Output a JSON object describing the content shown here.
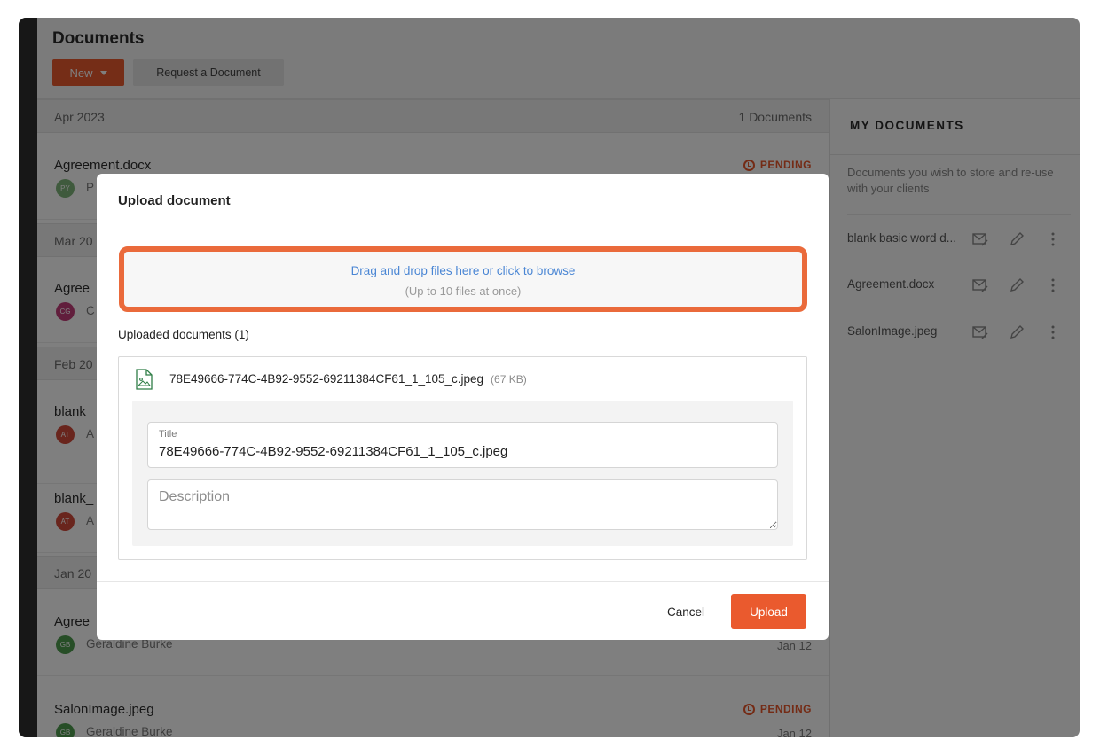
{
  "header": {
    "title": "Documents",
    "new_label": "New",
    "request_label": "Request a Document"
  },
  "list": {
    "groups": [
      {
        "month": "Apr 2023",
        "count": "1 Documents"
      },
      {
        "month": "Mar 20"
      },
      {
        "month": "Feb 20"
      },
      {
        "month": "Jan 20"
      }
    ],
    "rows": [
      {
        "name": "Agreement.docx",
        "initials": "PY",
        "owner": "P",
        "status": "PENDING"
      },
      {
        "name": "Agree",
        "initials": "CG",
        "owner": "C"
      },
      {
        "name": "blank ",
        "initials": "AT",
        "owner": "A"
      },
      {
        "name": "blank_",
        "initials": "AT",
        "owner": "A"
      },
      {
        "name": "Agree",
        "initials": "GB",
        "owner": "Geraldine Burke",
        "date": "Jan 12"
      },
      {
        "name": "SalonImage.jpeg",
        "initials": "GB",
        "owner": "Geraldine Burke",
        "status": "PENDING",
        "date": "Jan 12"
      }
    ]
  },
  "sidebar": {
    "title": "MY DOCUMENTS",
    "description": "Documents you wish to store and re-use with your clients",
    "items": [
      {
        "name": "blank basic word d..."
      },
      {
        "name": "Agreement.docx"
      },
      {
        "name": "SalonImage.jpeg"
      }
    ]
  },
  "modal": {
    "title": "Upload document",
    "dropzone_main": "Drag and drop files here or click to browse",
    "dropzone_sub": "(Up to 10 files at once)",
    "uploaded_label": "Uploaded documents (1)",
    "file": {
      "name": "78E49666-774C-4B92-9552-69211384CF61_1_105_c.jpeg",
      "size": "(67 KB)",
      "title_label": "Title",
      "title_value": "78E49666-774C-4B92-9552-69211384CF61_1_105_c.jpeg",
      "description_placeholder": "Description"
    },
    "cancel_label": "Cancel",
    "upload_label": "Upload"
  },
  "colors": {
    "accent": "#ea5a2e",
    "link": "#4a86d4",
    "dropzone_border": "#ea6a3b"
  }
}
